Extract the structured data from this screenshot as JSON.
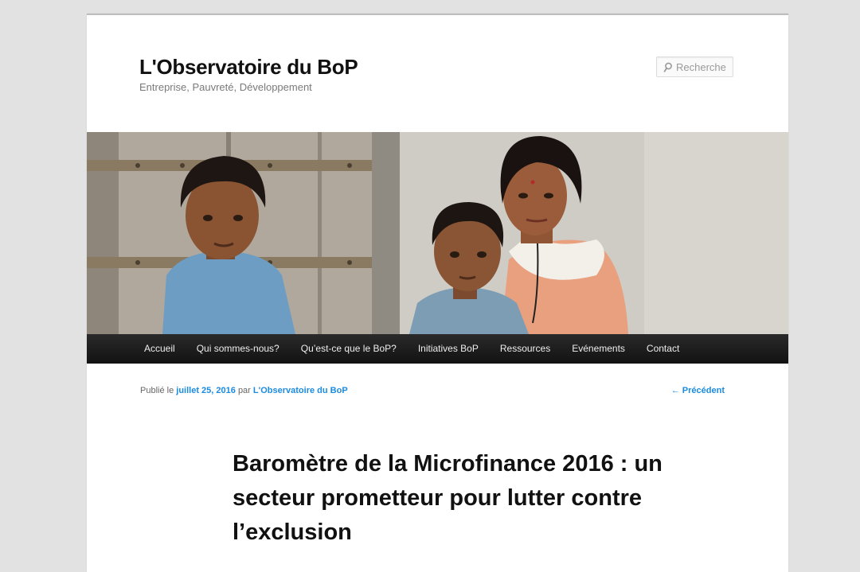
{
  "site": {
    "title": "L'Observatoire du BoP",
    "description": "Entreprise, Pauvreté, Développement"
  },
  "search": {
    "placeholder": "Recherche",
    "icon": "search-icon"
  },
  "nav": {
    "items": [
      {
        "label": "Accueil"
      },
      {
        "label": "Qui sommes-nous?"
      },
      {
        "label": "Qu’est-ce que le BoP?"
      },
      {
        "label": "Initiatives BoP"
      },
      {
        "label": "Ressources"
      },
      {
        "label": "Evénements"
      },
      {
        "label": "Contact"
      }
    ]
  },
  "post": {
    "published_prefix": "Publié le",
    "date": "juillet 25, 2016",
    "author_prefix": "par",
    "author": "L'Observatoire du BoP",
    "prev_link": "← Précédent",
    "title": "Baromètre de la Microfinance 2016 : un secteur prometteur pour lutter contre l’exclusion"
  },
  "colors": {
    "link": "#1b8be0",
    "nav_bg": "#1c1c1c",
    "page_bg": "#e2e2e2"
  }
}
